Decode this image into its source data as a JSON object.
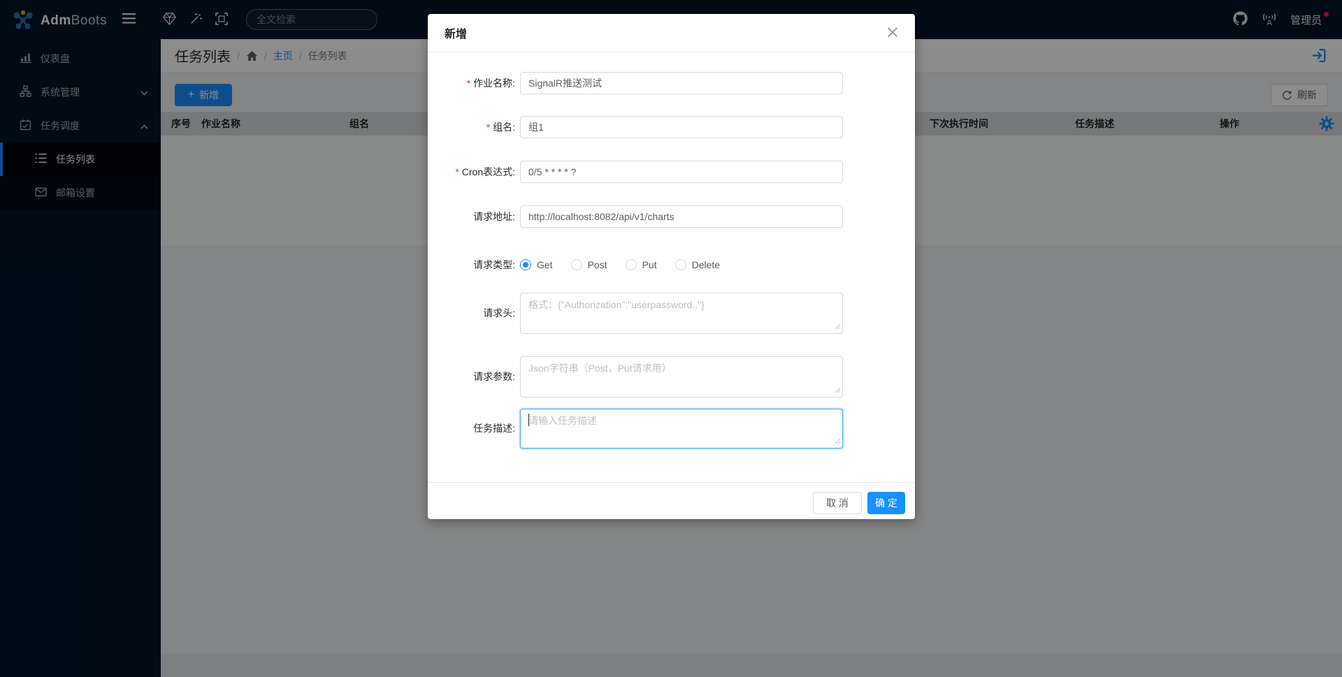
{
  "header": {
    "brand_bold": "Adm",
    "brand_light": "Boots",
    "search_placeholder": "全文检索",
    "user_name": "管理员"
  },
  "sidebar": {
    "items": [
      {
        "label": "仪表盘",
        "icon": "dashboard"
      },
      {
        "label": "系统管理",
        "icon": "cluster",
        "state": "collapsed"
      },
      {
        "label": "任务调度",
        "icon": "schedule",
        "state": "expanded"
      },
      {
        "label": "任务列表",
        "icon": "ordered-list",
        "state": "selected"
      },
      {
        "label": "邮箱设置",
        "icon": "mail"
      }
    ]
  },
  "breadcrumb": {
    "page_title": "任务列表",
    "sep": "/",
    "home_crumb": "主页",
    "current_crumb": "任务列表"
  },
  "toolbar": {
    "add_label": "新增",
    "add_plus": "+",
    "refresh_label": "刷新"
  },
  "table": {
    "headers": [
      "序号",
      "作业名称",
      "组名",
      "下次执行时间",
      "任务描述",
      "操作"
    ]
  },
  "modal": {
    "title": "新增",
    "close_glyph": "×",
    "fields": [
      {
        "label": "作业名称:",
        "required": true,
        "value": "SignalR推送测试"
      },
      {
        "label": "组名:",
        "required": true,
        "value": "组1"
      },
      {
        "label": "Cron表达式:",
        "required": true,
        "value": "0/5 * * * * ?"
      },
      {
        "label": "请求地址:",
        "required": false,
        "value": "http://localhost:8082/api/v1/charts"
      },
      {
        "label": "请求类型:",
        "required": false,
        "options": [
          "Get",
          "Post",
          "Put",
          "Delete"
        ],
        "selected": "Get"
      },
      {
        "label": "请求头:",
        "required": false,
        "placeholder": "格式：{\"Authorization\":\"userpassword..\"}"
      },
      {
        "label": "请求参数:",
        "required": false,
        "placeholder": "Json字符串（Post，Put请求用）"
      },
      {
        "label": "任务描述:",
        "required": false,
        "placeholder": "请输入任务描述",
        "focused": true
      }
    ],
    "footer": {
      "cancel": "取 消",
      "ok": "确 定"
    }
  },
  "colors": {
    "primary": "#1890ff",
    "sider_bg": "#001529",
    "submenu_bg": "#000c17",
    "required_mark": "#f5222d",
    "badge_dot": "#f5222d"
  }
}
